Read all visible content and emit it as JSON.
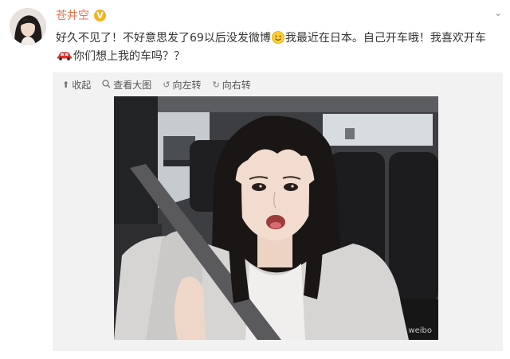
{
  "user": {
    "name": "苍井空",
    "verified_mark": "V"
  },
  "post": {
    "text_part1": "好久不见了！不好意思发了69以后没发微博",
    "text_part2": "我最近在日本。自己开车哦！我喜欢开车",
    "text_part3": "你们想上我的车吗？？",
    "emoji_icon": "smile-emoji-icon",
    "car_emoji_icon": "red-car-emoji-icon"
  },
  "toolbar": {
    "collapse_label": "收起",
    "view_large_label": "查看大图",
    "rotate_left_label": "向左转",
    "rotate_right_label": "向右转"
  },
  "photo": {
    "watermark": "weibo",
    "description_icon": "selfie-photo"
  },
  "colors": {
    "username": "#eb7350",
    "text": "#333333",
    "media_bg": "#f2f2f2",
    "verified_badge": "#f5b321"
  }
}
